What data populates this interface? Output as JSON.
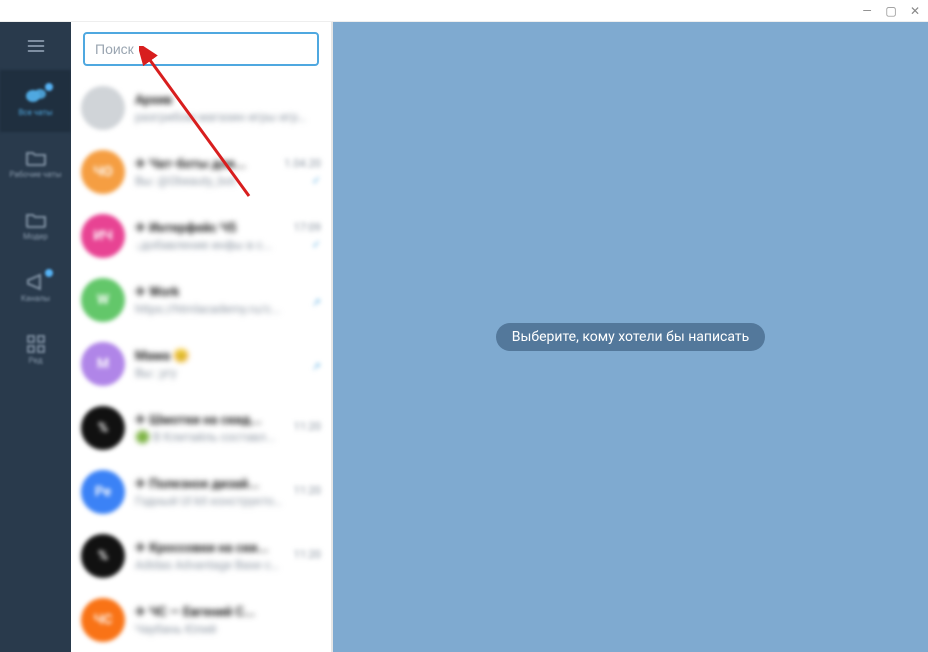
{
  "window": {
    "minimize": "—",
    "maximize": "▢",
    "close": "✕"
  },
  "sidebar": {
    "items": [
      {
        "label": "Все чаты",
        "icon": "chats",
        "active": true,
        "badge": true
      },
      {
        "label": "Рабочие чаты",
        "icon": "folder",
        "active": false,
        "badge": false
      },
      {
        "label": "Модер",
        "icon": "folder",
        "active": false,
        "badge": false
      },
      {
        "label": "Каналы",
        "icon": "bullhorn",
        "active": false,
        "badge": true
      },
      {
        "label": "Ред",
        "icon": "grid",
        "active": false,
        "badge": false
      }
    ]
  },
  "search": {
    "placeholder": "Поиск",
    "value": ""
  },
  "chats": [
    {
      "avatar_bg": "#d0d4d8",
      "avatar_text": "",
      "title": "Архив",
      "subtitle": "разгрибом магазин игры игру...",
      "time": "",
      "mark": ""
    },
    {
      "avatar_bg": "#f59e42",
      "avatar_text": "ЧО",
      "title": "✈ Чат-боты для...",
      "subtitle": "Вы: @Obeauty_bot",
      "time": "1.04.20",
      "mark": "✓"
    },
    {
      "avatar_bg": "#e84393",
      "avatar_text": "ИЧ",
      "title": "✈ Интерфейс Ч5",
      "subtitle": "↓добавление инфы в с...",
      "time": "17:09",
      "mark": "✓"
    },
    {
      "avatar_bg": "#63c76a",
      "avatar_text": "W",
      "title": "✈ Work",
      "subtitle": "https://htmlacademy.ru/c...",
      "time": "",
      "mark": "↗"
    },
    {
      "avatar_bg": "#b085e8",
      "avatar_text": "М",
      "title": "Мама 😊",
      "subtitle": "Вы: ;угу",
      "time": "",
      "mark": "↗"
    },
    {
      "avatar_bg": "#111",
      "avatar_text": "%",
      "title": "✈ Шмотки на скид...",
      "subtitle": "🟢 В Клитайль составл...",
      "time": "11:20",
      "mark": ""
    },
    {
      "avatar_bg": "#3b82f6",
      "avatar_text": "Ре",
      "title": "✈ Полезное дизай...",
      "subtitle": "Годный UI kit конструктор...",
      "time": "11:20",
      "mark": ""
    },
    {
      "avatar_bg": "#111",
      "avatar_text": "%",
      "title": "✈ Кроссовки на ски...",
      "subtitle": "Adidas Advantage Base стар...",
      "time": "11:20",
      "mark": ""
    },
    {
      "avatar_bg": "#f97316",
      "avatar_text": "ЧС",
      "title": "✈ ЧС — Евгений С...",
      "subtitle": "Чаубань Юлий",
      "time": "",
      "mark": ""
    }
  ],
  "content": {
    "placeholder": "Выберите, кому хотели бы написать"
  }
}
